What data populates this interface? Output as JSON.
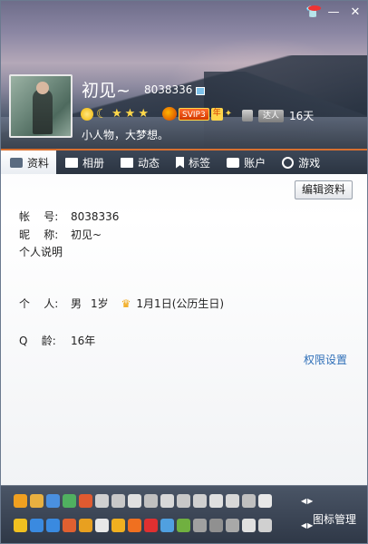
{
  "window": {
    "controls": [
      "skin-icon",
      "minimize-icon",
      "close-icon"
    ]
  },
  "profile": {
    "nickname": "初见~",
    "qq_number": "8038336",
    "signature": "小人物，大梦想。",
    "svip_label": "SVIP3",
    "svip_year": "年",
    "daren_label": "达人",
    "daren_days": "16天"
  },
  "tabs": [
    {
      "label": "资料",
      "icon": "profile-card-icon"
    },
    {
      "label": "相册",
      "icon": "photo-icon"
    },
    {
      "label": "动态",
      "icon": "feed-icon"
    },
    {
      "label": "标签",
      "icon": "bookmark-icon"
    },
    {
      "label": "账户",
      "icon": "briefcase-icon"
    },
    {
      "label": "游戏",
      "icon": "game-icon"
    }
  ],
  "content": {
    "edit_button": "编辑资料",
    "account_key": "帐    号:",
    "account_val": "8038336",
    "nick_key": "昵    称:",
    "nick_val": "初见~",
    "desc_label": "个人说明",
    "personal_key": "个    人:",
    "gender": "男",
    "age": "1岁",
    "birthday": "1月1日(公历生日)",
    "qage_key": "Q    龄:",
    "qage_val": "16年",
    "permission_link": "权限设置"
  },
  "iconbar": {
    "manage_label": "图标管理",
    "row1_colors": [
      "#f0a020",
      "#e8b040",
      "#4a90e0",
      "#50b060",
      "#e05a30",
      "#d0d0d0",
      "#c8c8c8",
      "#e0e0e0",
      "#c0c0c0",
      "#d8d8d8",
      "#c8c8c8",
      "#d0d0d0",
      "#e0e0e0",
      "#d8d8d8",
      "#c0c0c0",
      "#e8e8e8"
    ],
    "row2_colors": [
      "#f0c020",
      "#3a8ae0",
      "#3a8ae0",
      "#e06030",
      "#e8a020",
      "#e8e8e8",
      "#f0b020",
      "#f07020",
      "#e03030",
      "#50a0e0",
      "#70b040",
      "#a0a0a0",
      "#909090",
      "#a8a8a8",
      "#e0e0e0",
      "#d0d0d0"
    ]
  }
}
